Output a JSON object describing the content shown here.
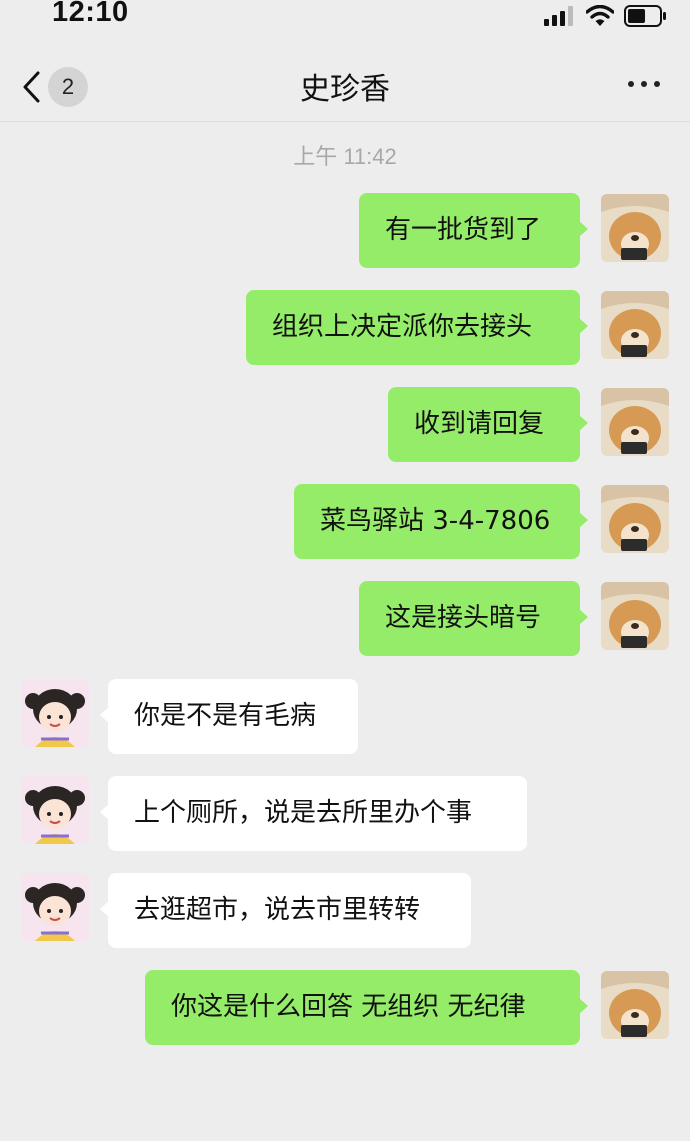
{
  "status_bar": {
    "time": "12:10"
  },
  "nav": {
    "back_badge": "2",
    "title": "史珍香"
  },
  "chat": {
    "timestamp": "上午 11:42",
    "messages": [
      {
        "side": "sent",
        "text": "有一批货到了"
      },
      {
        "side": "sent",
        "text": "组织上决定派你去接头"
      },
      {
        "side": "sent",
        "text": "收到请回复"
      },
      {
        "side": "sent",
        "text": "菜鸟驿站 3-4-7806"
      },
      {
        "side": "sent",
        "text": "这是接头暗号"
      },
      {
        "side": "received",
        "text": "你是不是有毛病"
      },
      {
        "side": "received",
        "text": "上个厕所，说是去所里办个事"
      },
      {
        "side": "received",
        "text": "去逛超市，说去市里转转"
      },
      {
        "side": "sent",
        "text": "你这是什么回答 无组织 无纪律"
      }
    ]
  },
  "colors": {
    "sent_bubble": "#95ec69",
    "received_bubble": "#ffffff",
    "background": "#ededed"
  }
}
